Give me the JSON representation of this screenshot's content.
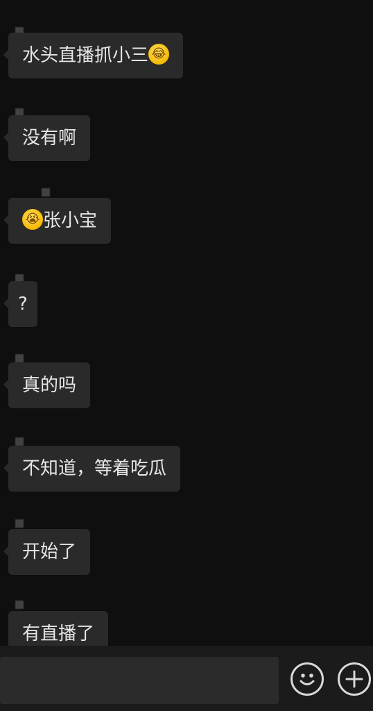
{
  "messages": [
    {
      "text": "水头直播抓小三",
      "emoji_after": "😂"
    },
    {
      "text": "没有啊"
    },
    {
      "text": "张小宝",
      "emoji_before": "😭"
    },
    {
      "text": "?"
    },
    {
      "text": "真的吗"
    },
    {
      "text": "不知道，等着吃瓜"
    },
    {
      "text": "开始了"
    },
    {
      "text": "有直播了"
    }
  ],
  "input": {
    "value": ""
  },
  "icons": {
    "emoji_button": "emoji-face-icon",
    "plus_button": "plus-circle-icon"
  },
  "colors": {
    "background": "#0f0f0f",
    "bubble": "#2a2a2a",
    "text": "#e6e6e6"
  }
}
